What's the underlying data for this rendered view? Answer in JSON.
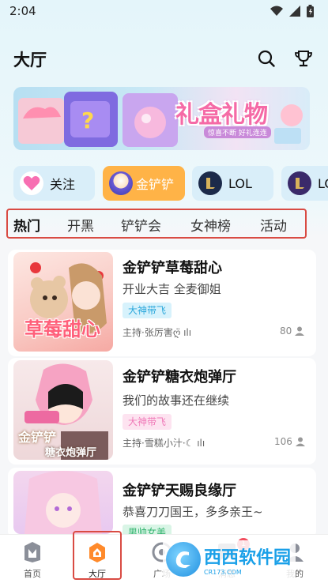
{
  "status_bar": {
    "time": "2:04"
  },
  "header": {
    "title": "大厅",
    "search_icon": "search-icon",
    "trophy_icon": "trophy-icon"
  },
  "banner": {
    "title": "礼盒礼物",
    "subtitle": "惊喜不断 好礼连连"
  },
  "chips": [
    {
      "label": "关注",
      "icon": "heart-icon"
    },
    {
      "label": "金铲铲",
      "icon": "game-avatar-icon",
      "active": true
    },
    {
      "label": "LOL",
      "icon": "lol-icon"
    },
    {
      "label": "LO",
      "icon": "lol-icon"
    }
  ],
  "tabs": [
    {
      "label": "热门",
      "active": true
    },
    {
      "label": "开黑"
    },
    {
      "label": "铲铲会"
    },
    {
      "label": "女神榜"
    },
    {
      "label": "活动"
    }
  ],
  "rooms": [
    {
      "title": "金铲铲草莓甜心",
      "desc": "开业大吉 全麦御姐",
      "tag": "大神带飞",
      "host": "主持·张厉害ღ̈ ılı",
      "count": "80",
      "cover_text": "草莓甜心"
    },
    {
      "title": "金铲铲糖衣炮弹厅",
      "desc": "我们的故事还在继续",
      "tag": "大神带飞",
      "host": "主持·雪糕小汁·☾ ılı",
      "count": "106",
      "cover_text_1": "金铲铲",
      "cover_text_2": "糖衣炮弹厅"
    },
    {
      "title": "金铲铲天赐良缘厅",
      "desc": "恭喜刀刀国王，多多亲王~",
      "tag": "男帅女美"
    }
  ],
  "bottom_nav": [
    {
      "label": "首页",
      "icon": "home-icon"
    },
    {
      "label": "大厅",
      "icon": "hall-icon",
      "active": true
    },
    {
      "label": "广场",
      "icon": "plaza-icon"
    },
    {
      "label": "消息",
      "icon": "message-icon",
      "badge": "1"
    },
    {
      "label": "我的",
      "icon": "profile-icon"
    }
  ],
  "watermark": {
    "text": "西西软件园",
    "sub": "CR173.COM"
  },
  "colors": {
    "accent": "#ffb347",
    "highlight_border": "#d94b43",
    "tag_blue": "#3cb6e6",
    "tag_pink": "#f07ab8"
  }
}
